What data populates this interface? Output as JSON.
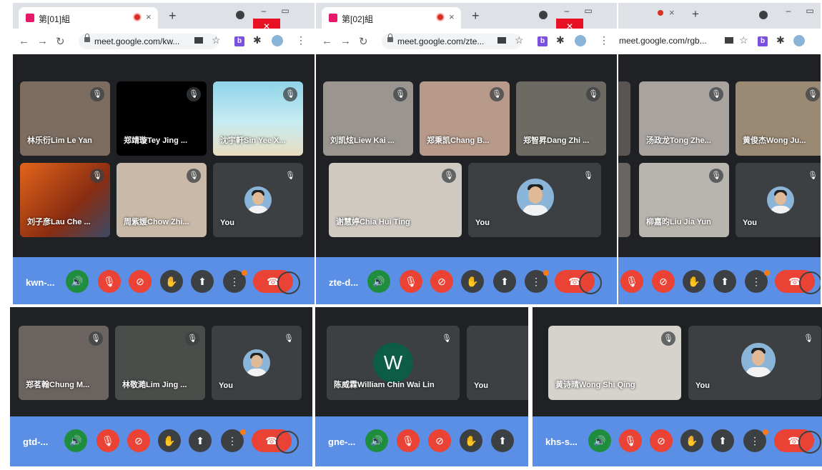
{
  "windows": [
    {
      "tab_title": "第[01]組",
      "url": "meet.google.com/kw...",
      "meeting_code": "kwn-...",
      "participants": [
        "林乐衍Lim Le Yan",
        "郑靖璇Tey Jing ...",
        "沈宇軒Sin Yee X...",
        "刘子彦Lau Che ...",
        "周紫媛Chow Zhi...",
        "You"
      ]
    },
    {
      "tab_title": "第[02]組",
      "url": "meet.google.com/zte...",
      "meeting_code": "zte-d...",
      "participants": [
        "刘凯炫Liew Kai ...",
        "郑秉凯Chang B...",
        "郑智昇Dang Zhi ...",
        "谢慧婷Chia Hui Ting",
        "You"
      ]
    },
    {
      "tab_title": "",
      "url": "meet.google.com/rgb...",
      "meeting_code": "",
      "participants": [
        "汤政龙Tong Zhe...",
        "黄俊杰Wong Ju...",
        "柳嘉昀Liu Jia Yun",
        "You"
      ]
    },
    {
      "meeting_code": "gtd-...",
      "participants": [
        "郑茗翰Chung M...",
        "林敬澔Lim Jing ...",
        "You"
      ]
    },
    {
      "meeting_code": "gne-...",
      "participants": [
        "陈威霖William Chin Wai Lin",
        "You"
      ],
      "avatar_letter": "W"
    },
    {
      "meeting_code": "khs-s...",
      "participants": [
        "黄诗晴Wong Shi Qing",
        "You"
      ]
    }
  ],
  "icons": {
    "mic_off": "🎙",
    "speaker": "🔊",
    "cam_off": "⊘",
    "hand": "✋",
    "present": "⬆",
    "more": "⋮",
    "end_call": "☎",
    "new_tab": "+",
    "close": "×",
    "back": "←",
    "forward": "→",
    "reload": "↻",
    "star": "☆",
    "chevron_up": "^"
  },
  "colors": {
    "meet_bg": "#202124",
    "tile_bg": "#3c4043",
    "control_bar": "#5b8fe6",
    "red": "#ea4335",
    "green": "#1e8e3e"
  }
}
